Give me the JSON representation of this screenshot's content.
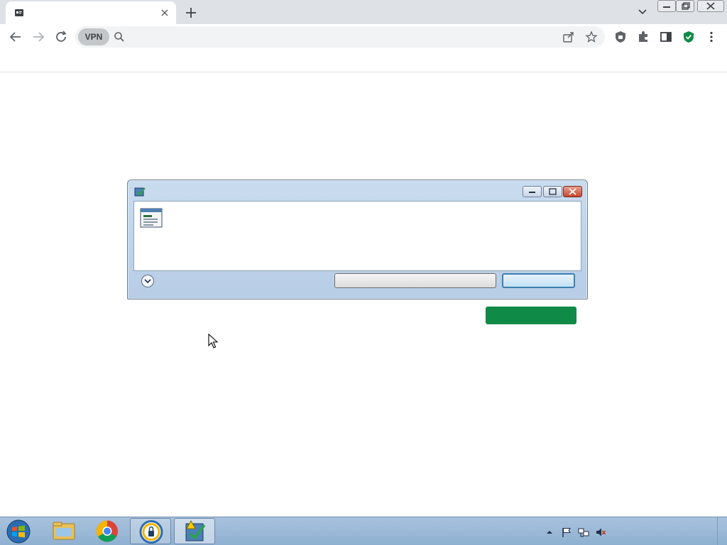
{
  "browser": {
    "tab": {
      "title": ""
    },
    "omnibox": {
      "vpn_label": "VPN",
      "text": ""
    },
    "accent_green": "#0f8a47"
  },
  "page": {
    "url_line": "",
    "link_text": "",
    "cta_label": ""
  },
  "dialog": {
    "title": "",
    "main_instruction": "",
    "content": "",
    "details_label": "",
    "alt_button_label": "",
    "default_button_label": ""
  },
  "taskbar": {
    "items": [
      "windows-explorer",
      "google-chrome",
      "lock-app",
      "installer-app"
    ],
    "clock_time": "",
    "clock_date": ""
  }
}
